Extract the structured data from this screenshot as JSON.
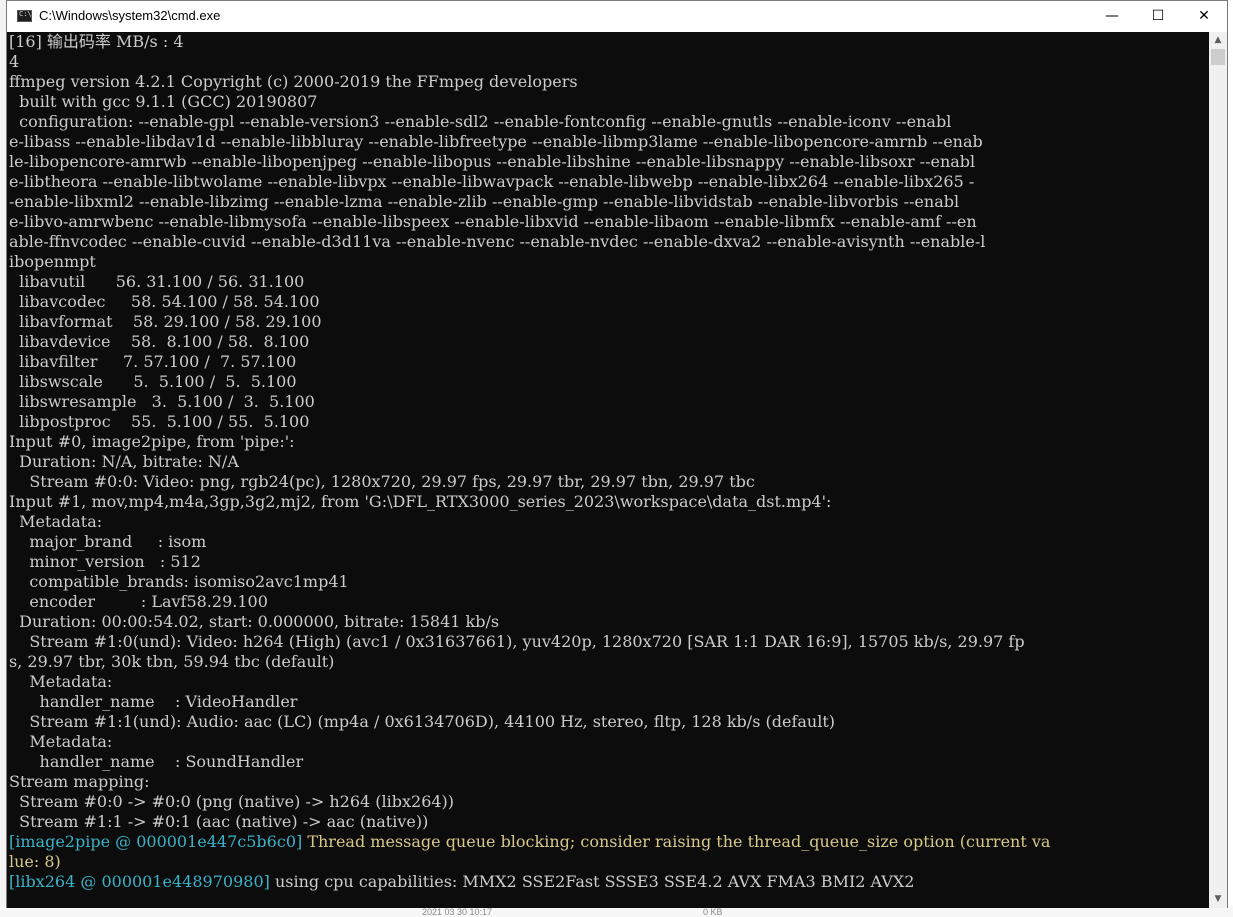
{
  "window": {
    "title": "C:\\Windows\\system32\\cmd.exe",
    "minimize_glyph": "—",
    "maximize_glyph": "☐",
    "close_glyph": "✕"
  },
  "background": {
    "timestamp": "2021 03 30 10:17",
    "size": "0 KB"
  },
  "console": {
    "lines": [
      {
        "segments": [
          {
            "text": "[16] 输出码率 MB/s : 4"
          }
        ]
      },
      {
        "segments": [
          {
            "text": "4"
          }
        ]
      },
      {
        "segments": [
          {
            "text": "ffmpeg version 4.2.1 Copyright (c) 2000-2019 the FFmpeg developers"
          }
        ]
      },
      {
        "segments": [
          {
            "text": "  built with gcc 9.1.1 (GCC) 20190807"
          }
        ]
      },
      {
        "segments": [
          {
            "text": "  configuration: --enable-gpl --enable-version3 --enable-sdl2 --enable-fontconfig --enable-gnutls --enable-iconv --enabl"
          }
        ]
      },
      {
        "segments": [
          {
            "text": "e-libass --enable-libdav1d --enable-libbluray --enable-libfreetype --enable-libmp3lame --enable-libopencore-amrnb --enab"
          }
        ]
      },
      {
        "segments": [
          {
            "text": "le-libopencore-amrwb --enable-libopenjpeg --enable-libopus --enable-libshine --enable-libsnappy --enable-libsoxr --enabl"
          }
        ]
      },
      {
        "segments": [
          {
            "text": "e-libtheora --enable-libtwolame --enable-libvpx --enable-libwavpack --enable-libwebp --enable-libx264 --enable-libx265 -"
          }
        ]
      },
      {
        "segments": [
          {
            "text": "-enable-libxml2 --enable-libzimg --enable-lzma --enable-zlib --enable-gmp --enable-libvidstab --enable-libvorbis --enabl"
          }
        ]
      },
      {
        "segments": [
          {
            "text": "e-libvo-amrwbenc --enable-libmysofa --enable-libspeex --enable-libxvid --enable-libaom --enable-libmfx --enable-amf --en"
          }
        ]
      },
      {
        "segments": [
          {
            "text": "able-ffnvcodec --enable-cuvid --enable-d3d11va --enable-nvenc --enable-nvdec --enable-dxva2 --enable-avisynth --enable-l"
          }
        ]
      },
      {
        "segments": [
          {
            "text": "ibopenmpt"
          }
        ]
      },
      {
        "segments": [
          {
            "text": "  libavutil      56. 31.100 / 56. 31.100"
          }
        ]
      },
      {
        "segments": [
          {
            "text": "  libavcodec     58. 54.100 / 58. 54.100"
          }
        ]
      },
      {
        "segments": [
          {
            "text": "  libavformat    58. 29.100 / 58. 29.100"
          }
        ]
      },
      {
        "segments": [
          {
            "text": "  libavdevice    58.  8.100 / 58.  8.100"
          }
        ]
      },
      {
        "segments": [
          {
            "text": "  libavfilter     7. 57.100 /  7. 57.100"
          }
        ]
      },
      {
        "segments": [
          {
            "text": "  libswscale      5.  5.100 /  5.  5.100"
          }
        ]
      },
      {
        "segments": [
          {
            "text": "  libswresample   3.  5.100 /  3.  5.100"
          }
        ]
      },
      {
        "segments": [
          {
            "text": "  libpostproc    55.  5.100 / 55.  5.100"
          }
        ]
      },
      {
        "segments": [
          {
            "text": "Input #0, image2pipe, from 'pipe:':"
          }
        ]
      },
      {
        "segments": [
          {
            "text": "  Duration: N/A, bitrate: N/A"
          }
        ]
      },
      {
        "segments": [
          {
            "text": "    Stream #0:0: Video: png, rgb24(pc), 1280x720, 29.97 fps, 29.97 tbr, 29.97 tbn, 29.97 tbc"
          }
        ]
      },
      {
        "segments": [
          {
            "text": "Input #1, mov,mp4,m4a,3gp,3g2,mj2, from 'G:\\DFL_RTX3000_series_2023\\workspace\\data_dst.mp4':"
          }
        ]
      },
      {
        "segments": [
          {
            "text": "  Metadata:"
          }
        ]
      },
      {
        "segments": [
          {
            "text": "    major_brand     : isom"
          }
        ]
      },
      {
        "segments": [
          {
            "text": "    minor_version   : 512"
          }
        ]
      },
      {
        "segments": [
          {
            "text": "    compatible_brands: isomiso2avc1mp41"
          }
        ]
      },
      {
        "segments": [
          {
            "text": "    encoder         : Lavf58.29.100"
          }
        ]
      },
      {
        "segments": [
          {
            "text": "  Duration: 00:00:54.02, start: 0.000000, bitrate: 15841 kb/s"
          }
        ]
      },
      {
        "segments": [
          {
            "text": "    Stream #1:0(und): Video: h264 (High) (avc1 / 0x31637661), yuv420p, 1280x720 [SAR 1:1 DAR 16:9], 15705 kb/s, 29.97 fp"
          }
        ]
      },
      {
        "segments": [
          {
            "text": "s, 29.97 tbr, 30k tbn, 59.94 tbc (default)"
          }
        ]
      },
      {
        "segments": [
          {
            "text": "    Metadata:"
          }
        ]
      },
      {
        "segments": [
          {
            "text": "      handler_name    : VideoHandler"
          }
        ]
      },
      {
        "segments": [
          {
            "text": "    Stream #1:1(und): Audio: aac (LC) (mp4a / 0x6134706D), 44100 Hz, stereo, fltp, 128 kb/s (default)"
          }
        ]
      },
      {
        "segments": [
          {
            "text": "    Metadata:"
          }
        ]
      },
      {
        "segments": [
          {
            "text": "      handler_name    : SoundHandler"
          }
        ]
      },
      {
        "segments": [
          {
            "text": "Stream mapping:"
          }
        ]
      },
      {
        "segments": [
          {
            "text": "  Stream #0:0 -> #0:0 (png (native) -> h264 (libx264))"
          }
        ]
      },
      {
        "segments": [
          {
            "text": "  Stream #1:1 -> #0:1 (aac (native) -> aac (native))"
          }
        ]
      },
      {
        "segments": [
          {
            "text": "[image2pipe @ 000001e447c5b6c0] ",
            "kind": "tag"
          },
          {
            "text": "Thread message queue blocking; consider raising the thread_queue_size option (current va",
            "kind": "warn"
          }
        ]
      },
      {
        "segments": [
          {
            "text": "lue: 8)",
            "kind": "warn"
          }
        ]
      },
      {
        "segments": [
          {
            "text": "[libx264 @ 000001e448970980] ",
            "kind": "tag"
          },
          {
            "text": "using cpu capabilities: MMX2 SSE2Fast SSSE3 SSE4.2 AVX FMA3 BMI2 AVX2"
          }
        ]
      }
    ]
  },
  "scrollbar": {
    "up_glyph": "▲",
    "down_glyph": "▼"
  },
  "colors": {
    "console_bg": "#0c0c0c",
    "console_text": "#cccccc",
    "tag_text": "#3ab3c9",
    "warn_text": "#d8c98a"
  }
}
